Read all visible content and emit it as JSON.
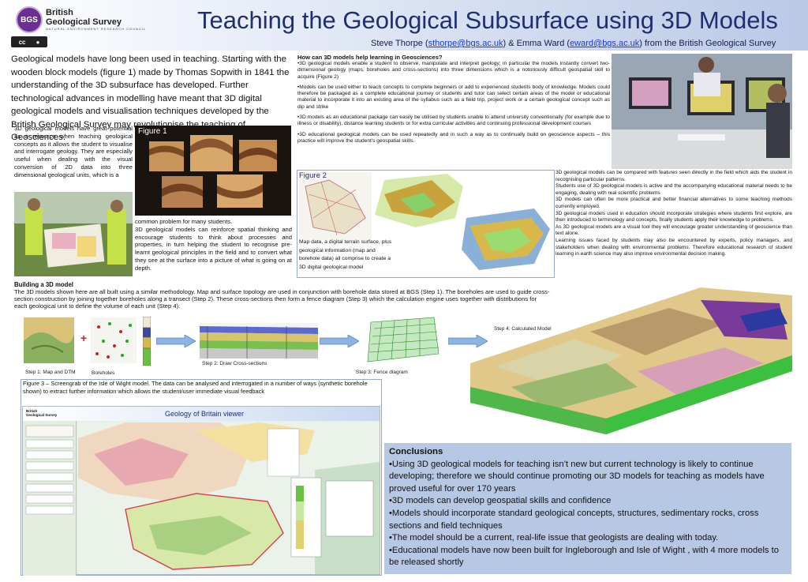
{
  "header": {
    "org_line1": "British",
    "org_line2": "Geological Survey",
    "org_sub": "NATURAL ENVIRONMENT RESEARCH COUNCIL",
    "logo_text": "BGS",
    "cc_text": "cc",
    "title": "Teaching the Geological Subsurface using 3D Models",
    "authors_prefix": "Steve Thorpe (",
    "email1": "sthorpe@bgs.ac.uk",
    "authors_mid": ") & Emma Ward (",
    "email2": "eward@bgs.ac.uk",
    "authors_suffix": ") from the British Geological Survey"
  },
  "intro": "Geological models have long been used in teaching. Starting with the wooden block models (figure 1) made by Thomas Sopwith in 1841 the understanding of the 3D subsurface has developed. Further technological advances in modelling have meant that 3D digital geological models and visualisation techniques developed by the British Geological Survey may revolutionise the teaching of Geosciences.",
  "col1_text": "3D geological models have great potential as a resource when teaching geological concepts as it allows the student to visualise and interrogate geology. They are especially useful when dealing with the visual conversion of 2D data into three dimensional geological units, which is a",
  "fig1_label": "Figure 1",
  "col2_text_a": "common problem for many students.",
  "col2_text_b": "3D geological models can reinforce spatial thinking and encourage students to think about processes and properties, in turn helping the student to recognise pre-learnt geological principles in the field and to convert what they see at the surface into a picture of what is going on at depth.",
  "how": {
    "heading": "How can 3D models help learning in Geosciences?",
    "p1": "•3D geological models enable a student to observe, manipulate and interpret geology; in particular the models instantly convert two-dimensional geology (maps, boreholes and cross-sections) into three dimensions which is a notoriously difficult geospatial skill to acquire (Figure 2)",
    "p2": "•Models can be used either to teach concepts to complete beginners or add to experienced students body of knowledge. Models could therefore be packaged as a complete educational journey or students and tutor can select certain areas of the model or educational material to incorporate it into an existing area of the syllabus such as a field trip, project work or a certain geological concept such as dip and strike",
    "p3": "•3D models as an educational package can easily be utilised by students unable to attend university conventionally (for example due to illness or disability), distance learning students or for extra curricular activities and continuing professional development courses",
    "p4": "•3D educational geological models can be used repeatedly and in such a way as to continually build on geoscience aspects – this practice will improve the student's geospatial skills."
  },
  "fig2_label": "Figure 2",
  "fig2_caption": "Map data, a digital terrain surface, plus geological information (map and borehole data) all comprise to create a 3D digital geological model",
  "right_text": "3D geological models can be compared with features seen directly in the field which aids the student in recognising particular patterns.\nStudents use of 3D geological models is active and the accompanying educational material needs to be engaging, dealing with real scientific problems\n3D models can often be more practical and better financial alternatives to some teaching methods currently employed.\n3D geological models used in education should incorporate strategies where students first explore, are then introduced to terminology and concepts, finally students apply their knowledge to problems.\nAs 3D geological models are a visual tool they will encourage greater understanding of geoscience than text alone.\nLearning issues faced by students may also be encountered by experts, policy managers, and stakeholders when dealing with environmental problems. Therefore educational research of student learning in earth science may also improve environmental decision making.",
  "building": {
    "heading": "Building a 3D model",
    "text": "The 3D models shown here are all built using a similar methodology. Map and surface topology are used in conjunction with borehole data stored at BGS (Step 1). The boreholes are used to guide cross-section construction by joining together boreholes along a transect (Step 2). These cross-sections then form a fence diagram (Step 3) which the calculation engine uses together with distributions for each geological unit to define the volume of each unit (Step 4).",
    "step1": "Step 1: Map and DTM",
    "boreholes": "Boreholes",
    "step2": "Step 2: Draw Cross-sections",
    "step3": "Step 3: Fence diagram",
    "step4": "Step 4: Calculated Model",
    "plus": "+"
  },
  "fig3_caption": "Figure 3 – Screengrab of the Isle of Wight model. The data can be analysed and interrogated in a number of ways (synthetic borehole shown) to extract further information which allows the student/user immediate visual feedback",
  "viewer": {
    "title": "Geology of Britain viewer",
    "logo_line1": "British",
    "logo_line2": "Geological Survey"
  },
  "conclusions": {
    "heading": "Conclusions",
    "items": [
      "•Using 3D geological models for teaching isn’t new but current technology is likely to continue developing; therefore we should continue promoting our 3D models for teaching as models have proved useful for over 170 years",
      "•3D models can develop geospatial skills and confidence",
      "•Models should incorporate standard geological concepts, structures, sedimentary rocks, cross sections and field techniques",
      "•The model should be a current, real-life issue that geologists are dealing with today.",
      "•Educational models have now been built for Ingleborough and Isle of Wight , with 4 more models to be released shortly"
    ]
  },
  "colors": {
    "title": "#1f2f6f",
    "conclusions_bg": "#b7c8e5",
    "link": "#1a3bd6"
  }
}
